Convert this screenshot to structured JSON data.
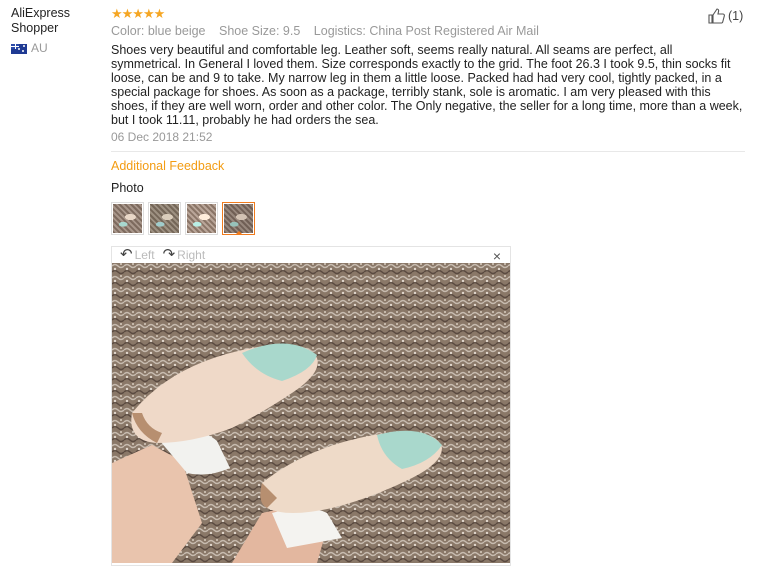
{
  "reviewer": {
    "name": "AliExpress Shopper",
    "country": "AU"
  },
  "review": {
    "stars": "★★★★★",
    "rating": 5,
    "color": "Color: blue beige",
    "shoe_size": "Shoe Size: 9.5",
    "logistics": "Logistics: China Post Registered Air Mail",
    "text": "Shoes very beautiful and comfortable leg. Leather soft, seems really natural. All seams are perfect, all symmetrical. In General I loved them. Size corresponds exactly to the grid. The foot 26.3 I took 9.5, thin socks fit loose, can be and 9 to take. My narrow leg in them a little loose. Packed had had very cool, tightly packed, in a special package for shoes. As soon as a package, terribly stank, sole is aromatic. I am very pleased with this shoes, if they are well worn, order and other color. The Only negative, the seller for a long time, more than a week, but I took 11.11, probably he had orders the sea.",
    "date": "06 Dec 2018 21:52",
    "helpful_count": "(1)"
  },
  "additional": {
    "label": "Additional Feedback",
    "photo_label": "Photo"
  },
  "thumbs": [
    {
      "icon": "photo-thumbnail"
    },
    {
      "icon": "photo-thumbnail"
    },
    {
      "icon": "photo-thumbnail"
    },
    {
      "icon": "photo-thumbnail",
      "active": true
    }
  ],
  "viewer": {
    "rotate_left": "Left",
    "rotate_right": "Right",
    "close": "×"
  },
  "colors": {
    "accent": "#f39c12",
    "star": "#f5a623",
    "active_border": "#f07b1d"
  }
}
